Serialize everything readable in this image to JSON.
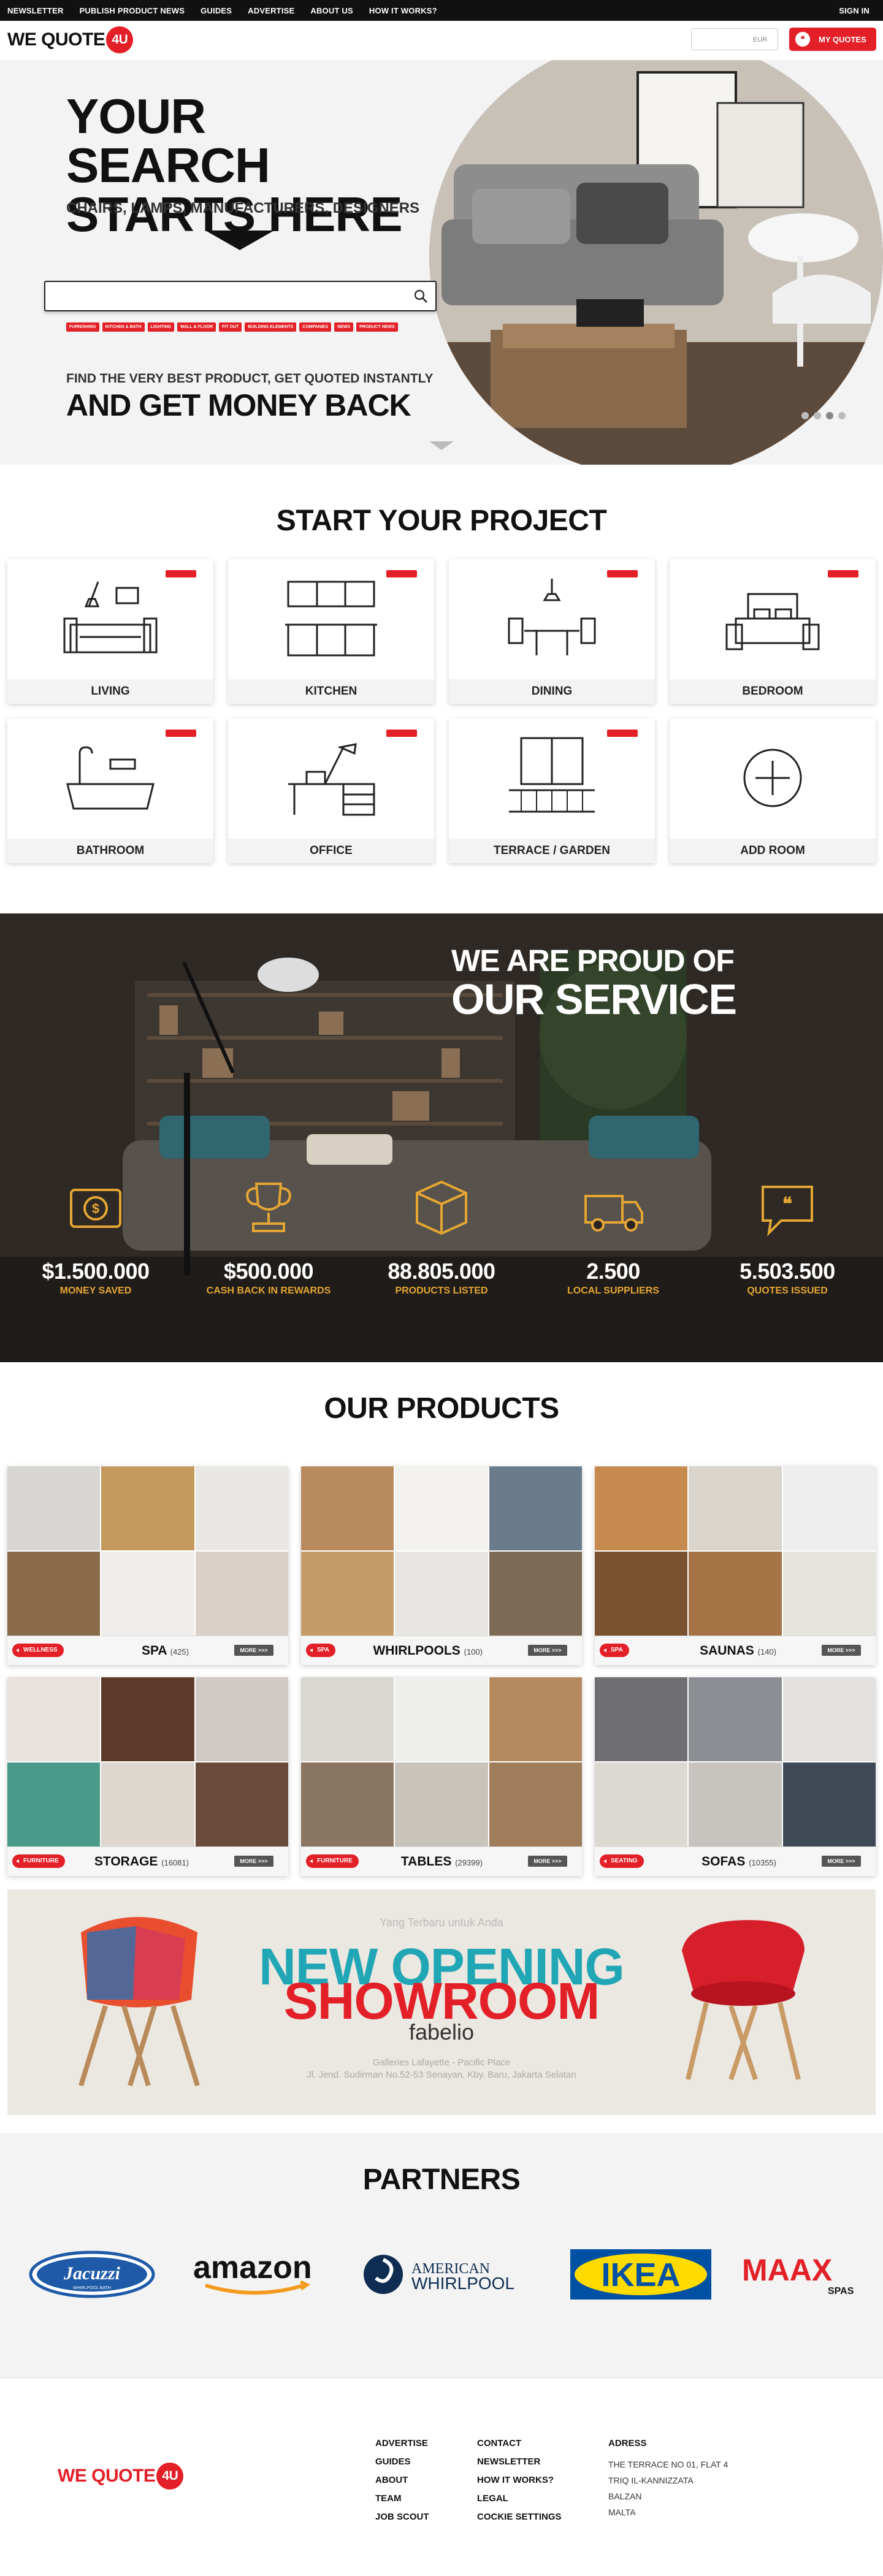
{
  "topnav": {
    "links": [
      "NEWSLETTER",
      "PUBLISH PRODUCT NEWS",
      "GUIDES",
      "ADVERTISE",
      "ABOUT US",
      "HOW IT WORKS?"
    ],
    "signin": "SIGN IN"
  },
  "header": {
    "logo_text": "WE QUOTE",
    "logo_num": "4U",
    "currency": "EUR",
    "myquotes": "MY QUOTES"
  },
  "hero": {
    "title_line1": "YOUR SEARCH",
    "title_line2": "STARTS HERE",
    "subtitle": "CHAIRS, LAMPS, MANUFACTURERS, DESIGNERS",
    "search_placeholder": "",
    "chips": [
      "FURNISHING",
      "KITCHEN & BATH",
      "LIGHTING",
      "WALL & FLOOR",
      "FIT OUT",
      "BUILDING ELEMENTS",
      "COMPANIES",
      "NEWS",
      "PRODUCT NEWS"
    ],
    "find_text": "FIND THE VERY BEST PRODUCT, GET QUOTED INSTANTLY",
    "money_text": "AND GET MONEY BACK",
    "slides": 4,
    "active_slide": 2
  },
  "project": {
    "title": "START YOUR PROJECT",
    "cards": [
      {
        "label": "LIVING",
        "icon": "sofa-icon"
      },
      {
        "label": "KITCHEN",
        "icon": "kitchen-cabinet-icon"
      },
      {
        "label": "DINING",
        "icon": "dining-table-icon"
      },
      {
        "label": "BEDROOM",
        "icon": "bed-icon"
      },
      {
        "label": "BATHROOM",
        "icon": "bathtub-icon"
      },
      {
        "label": "OFFICE",
        "icon": "desk-icon"
      },
      {
        "label": "TERRACE / GARDEN",
        "icon": "terrace-icon"
      },
      {
        "label": "ADD ROOM",
        "icon": "plus-circle-icon"
      }
    ]
  },
  "proud": {
    "line1": "WE ARE PROUD OF",
    "line2": "OUR SERVICE",
    "stats": [
      {
        "value": "$1.500.000",
        "caption": "MONEY SAVED",
        "icon": "money-icon"
      },
      {
        "value": "$500.000",
        "caption": "CASH BACK IN REWARDS",
        "icon": "trophy-icon"
      },
      {
        "value": "88.805.000",
        "caption": "PRODUCTS LISTED",
        "icon": "box-icon"
      },
      {
        "value": "2.500",
        "caption": "LOCAL SUPPLIERS",
        "icon": "van-icon"
      },
      {
        "value": "5.503.500",
        "caption": "QUOTES ISSUED",
        "icon": "chat-quote-icon"
      }
    ]
  },
  "products": {
    "title": "OUR PRODUCTS",
    "more": "MORE >>>",
    "items": [
      {
        "category": "WELLNESS",
        "name": "SPA",
        "count": "(425)"
      },
      {
        "category": "SPA",
        "name": "WHIRLPOOLS",
        "count": "(100)"
      },
      {
        "category": "SPA",
        "name": "SAUNAS",
        "count": "(140)"
      },
      {
        "category": "FURNITURE",
        "name": "STORAGE",
        "count": "(16081)"
      },
      {
        "category": "FURNITURE",
        "name": "TABLES",
        "count": "(29399)"
      },
      {
        "category": "SEATING",
        "name": "SOFAS",
        "count": "(10355)"
      }
    ]
  },
  "banner": {
    "small": "Yang Terbaru untuk Anda",
    "line1": "NEW OPENING",
    "line2": "SHOWROOM",
    "brand": "fabelio",
    "addr1": "Galleries Lafayette - Pacific Place",
    "addr2": "Jl. Jend. Sudirman No.52-53 Senayan, Kby. Baru, Jakarta Selatan"
  },
  "partners": {
    "title": "PARTNERS",
    "logos": [
      "Jacuzzi",
      "amazon",
      "AMERICAN WHIRLPOOL",
      "IKEA",
      "MAAX"
    ],
    "jacuzzi_sub": "WHIRLPOOL BATH",
    "american": "AMERICAN",
    "whirlpool": "WHIRLPOOL",
    "maax_sub": "SPAS"
  },
  "footer": {
    "col1": [
      "ADVERTISE",
      "GUIDES",
      "ABOUT",
      "TEAM",
      "JOB SCOUT"
    ],
    "col2": [
      "CONTACT",
      "NEWSLETTER",
      "HOW IT WORKS?",
      "LEGAL",
      "COCKIE SETTINGS"
    ],
    "address_title": "ADRESS",
    "address": [
      "THE TERRACE NO 01, FLAT 4",
      "TRIQ IL-KANNIZZATA",
      "BALZAN",
      "MALTA"
    ]
  },
  "colors": {
    "accent": "#e32027",
    "gold": "#e4a633",
    "teal": "#21a6b5"
  }
}
